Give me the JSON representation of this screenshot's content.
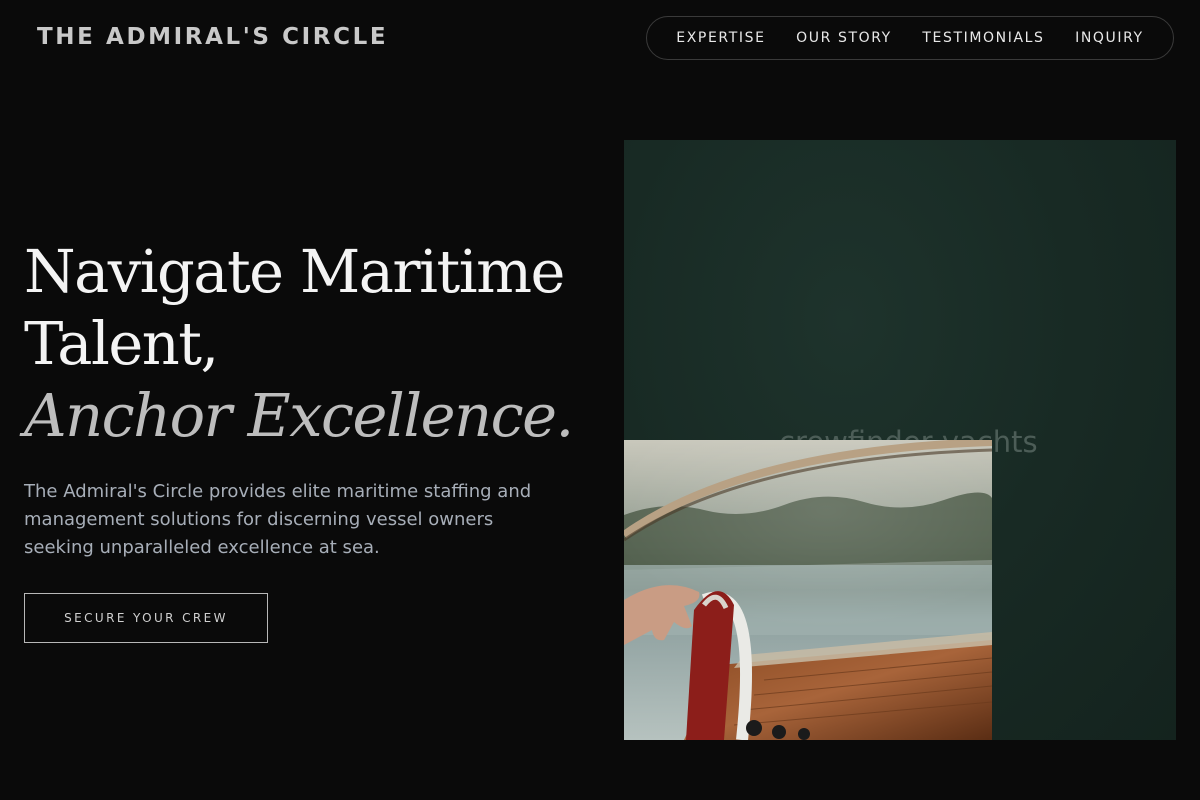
{
  "brand": {
    "name": "THE ADMIRAL'S CIRCLE"
  },
  "nav": {
    "items": [
      {
        "label": "EXPERTISE"
      },
      {
        "label": "OUR STORY"
      },
      {
        "label": "TESTIMONIALS"
      },
      {
        "label": "INQUIRY"
      }
    ]
  },
  "hero": {
    "headline_line1": "Navigate Maritime",
    "headline_line2": "Talent,",
    "headline_line3": "Anchor Excellence.",
    "lede": "The Admiral's Circle provides elite maritime staffing and management solutions for discerning vessel owners seeking unparalleled excellence at sea.",
    "cta_label": "SECURE YOUR CREW"
  },
  "images": {
    "back_watermark": "crewfinder yachts",
    "back_description_color": "#182a24",
    "front_subject": "boat-wheel-photo"
  },
  "colors": {
    "background": "#0a0a0a",
    "headline": "#f4f4f4",
    "headline_italic": "#bdbdbd",
    "body_text": "#a7aeb8",
    "accent_green": "#182a24"
  }
}
